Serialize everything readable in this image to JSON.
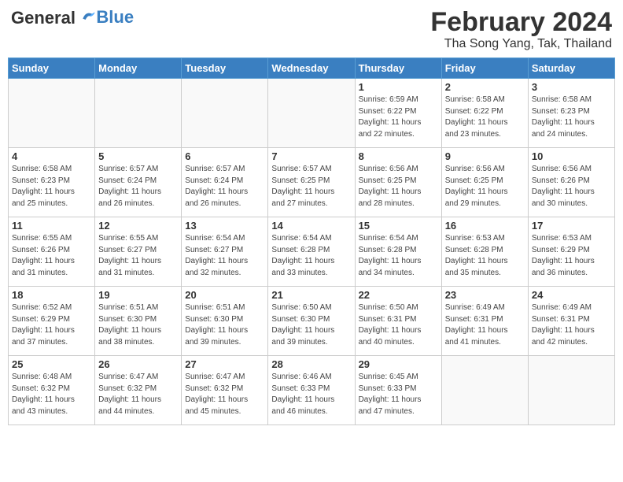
{
  "logo": {
    "general": "General",
    "blue": "Blue"
  },
  "title": {
    "month": "February 2024",
    "location": "Tha Song Yang, Tak, Thailand"
  },
  "days_of_week": [
    "Sunday",
    "Monday",
    "Tuesday",
    "Wednesday",
    "Thursday",
    "Friday",
    "Saturday"
  ],
  "weeks": [
    [
      {
        "day": "",
        "info": ""
      },
      {
        "day": "",
        "info": ""
      },
      {
        "day": "",
        "info": ""
      },
      {
        "day": "",
        "info": ""
      },
      {
        "day": "1",
        "info": "Sunrise: 6:59 AM\nSunset: 6:22 PM\nDaylight: 11 hours\nand 22 minutes."
      },
      {
        "day": "2",
        "info": "Sunrise: 6:58 AM\nSunset: 6:22 PM\nDaylight: 11 hours\nand 23 minutes."
      },
      {
        "day": "3",
        "info": "Sunrise: 6:58 AM\nSunset: 6:23 PM\nDaylight: 11 hours\nand 24 minutes."
      }
    ],
    [
      {
        "day": "4",
        "info": "Sunrise: 6:58 AM\nSunset: 6:23 PM\nDaylight: 11 hours\nand 25 minutes."
      },
      {
        "day": "5",
        "info": "Sunrise: 6:57 AM\nSunset: 6:24 PM\nDaylight: 11 hours\nand 26 minutes."
      },
      {
        "day": "6",
        "info": "Sunrise: 6:57 AM\nSunset: 6:24 PM\nDaylight: 11 hours\nand 26 minutes."
      },
      {
        "day": "7",
        "info": "Sunrise: 6:57 AM\nSunset: 6:25 PM\nDaylight: 11 hours\nand 27 minutes."
      },
      {
        "day": "8",
        "info": "Sunrise: 6:56 AM\nSunset: 6:25 PM\nDaylight: 11 hours\nand 28 minutes."
      },
      {
        "day": "9",
        "info": "Sunrise: 6:56 AM\nSunset: 6:25 PM\nDaylight: 11 hours\nand 29 minutes."
      },
      {
        "day": "10",
        "info": "Sunrise: 6:56 AM\nSunset: 6:26 PM\nDaylight: 11 hours\nand 30 minutes."
      }
    ],
    [
      {
        "day": "11",
        "info": "Sunrise: 6:55 AM\nSunset: 6:26 PM\nDaylight: 11 hours\nand 31 minutes."
      },
      {
        "day": "12",
        "info": "Sunrise: 6:55 AM\nSunset: 6:27 PM\nDaylight: 11 hours\nand 31 minutes."
      },
      {
        "day": "13",
        "info": "Sunrise: 6:54 AM\nSunset: 6:27 PM\nDaylight: 11 hours\nand 32 minutes."
      },
      {
        "day": "14",
        "info": "Sunrise: 6:54 AM\nSunset: 6:28 PM\nDaylight: 11 hours\nand 33 minutes."
      },
      {
        "day": "15",
        "info": "Sunrise: 6:54 AM\nSunset: 6:28 PM\nDaylight: 11 hours\nand 34 minutes."
      },
      {
        "day": "16",
        "info": "Sunrise: 6:53 AM\nSunset: 6:28 PM\nDaylight: 11 hours\nand 35 minutes."
      },
      {
        "day": "17",
        "info": "Sunrise: 6:53 AM\nSunset: 6:29 PM\nDaylight: 11 hours\nand 36 minutes."
      }
    ],
    [
      {
        "day": "18",
        "info": "Sunrise: 6:52 AM\nSunset: 6:29 PM\nDaylight: 11 hours\nand 37 minutes."
      },
      {
        "day": "19",
        "info": "Sunrise: 6:51 AM\nSunset: 6:30 PM\nDaylight: 11 hours\nand 38 minutes."
      },
      {
        "day": "20",
        "info": "Sunrise: 6:51 AM\nSunset: 6:30 PM\nDaylight: 11 hours\nand 39 minutes."
      },
      {
        "day": "21",
        "info": "Sunrise: 6:50 AM\nSunset: 6:30 PM\nDaylight: 11 hours\nand 39 minutes."
      },
      {
        "day": "22",
        "info": "Sunrise: 6:50 AM\nSunset: 6:31 PM\nDaylight: 11 hours\nand 40 minutes."
      },
      {
        "day": "23",
        "info": "Sunrise: 6:49 AM\nSunset: 6:31 PM\nDaylight: 11 hours\nand 41 minutes."
      },
      {
        "day": "24",
        "info": "Sunrise: 6:49 AM\nSunset: 6:31 PM\nDaylight: 11 hours\nand 42 minutes."
      }
    ],
    [
      {
        "day": "25",
        "info": "Sunrise: 6:48 AM\nSunset: 6:32 PM\nDaylight: 11 hours\nand 43 minutes."
      },
      {
        "day": "26",
        "info": "Sunrise: 6:47 AM\nSunset: 6:32 PM\nDaylight: 11 hours\nand 44 minutes."
      },
      {
        "day": "27",
        "info": "Sunrise: 6:47 AM\nSunset: 6:32 PM\nDaylight: 11 hours\nand 45 minutes."
      },
      {
        "day": "28",
        "info": "Sunrise: 6:46 AM\nSunset: 6:33 PM\nDaylight: 11 hours\nand 46 minutes."
      },
      {
        "day": "29",
        "info": "Sunrise: 6:45 AM\nSunset: 6:33 PM\nDaylight: 11 hours\nand 47 minutes."
      },
      {
        "day": "",
        "info": ""
      },
      {
        "day": "",
        "info": ""
      }
    ]
  ]
}
